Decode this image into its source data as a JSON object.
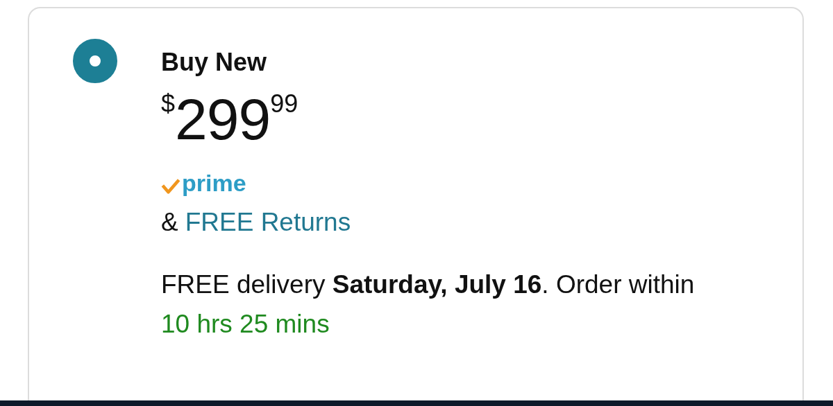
{
  "offer": {
    "selected": true,
    "label": "Buy New",
    "price": {
      "currency": "$",
      "whole": "299",
      "fraction": "99"
    },
    "prime_badge": "prime",
    "returns": {
      "prefix": "&",
      "link": "FREE Returns"
    },
    "delivery": {
      "text": "FREE delivery **Saturday, July 16**. Order within",
      "countdown": "10 hrs 25 mins"
    }
  }
}
